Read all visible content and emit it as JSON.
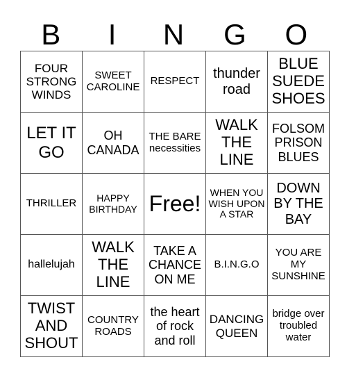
{
  "header": {
    "letters": [
      "B",
      "I",
      "N",
      "G",
      "O"
    ]
  },
  "board": {
    "rows": [
      [
        "FOUR STRONG WINDS",
        "SWEET CAROLINE",
        "RESPECT",
        "thunder road",
        "BLUE SUEDE SHOES"
      ],
      [
        "LET IT GO",
        "OH CANADA",
        "THE BARE necessities",
        "WALK THE LINE",
        "FOLSOM PRISON BLUES"
      ],
      [
        "THRILLER",
        "HAPPY BIRTHDAY",
        "Free!",
        "WHEN YOU WISH UPON A STAR",
        "DOWN BY THE BAY"
      ],
      [
        "hallelujah",
        "WALK THE LINE",
        "TAKE A CHANCE ON ME",
        "B.I.N.G.O",
        "YOU ARE MY SUNSHINE"
      ],
      [
        "TWIST AND SHOUT",
        "COUNTRY ROADS",
        "the heart of rock and roll",
        "DANCING QUEEN",
        "bridge over troubled water"
      ]
    ]
  }
}
